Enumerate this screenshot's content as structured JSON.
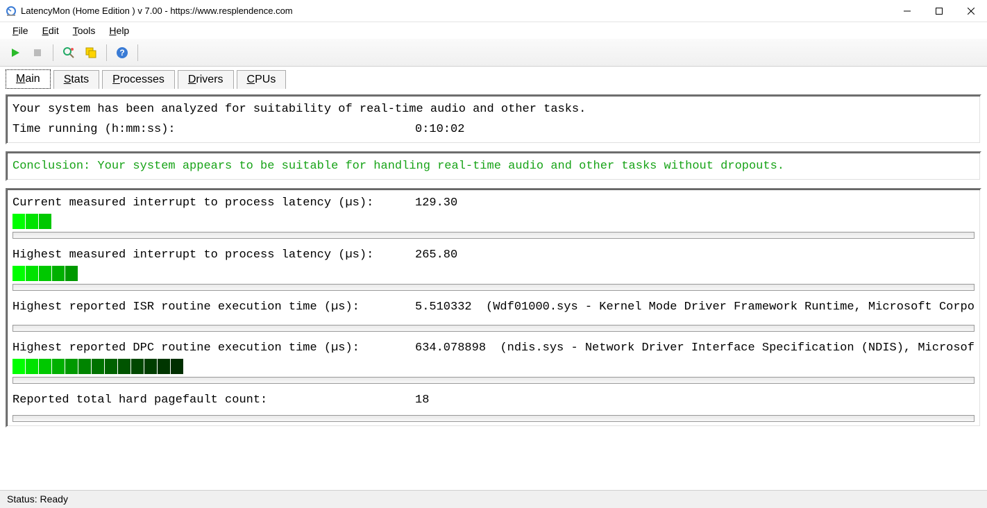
{
  "window": {
    "title": "LatencyMon  (Home Edition )  v 7.00 - https://www.resplendence.com"
  },
  "menu": {
    "file": "File",
    "edit": "Edit",
    "tools": "Tools",
    "help": "Help"
  },
  "tabs": {
    "main": "Main",
    "stats": "Stats",
    "processes": "Processes",
    "drivers": "Drivers",
    "cpus": "CPUs"
  },
  "summary": {
    "line1": "Your system has been analyzed for suitability of real-time audio and other tasks.",
    "time_label": "Time running (h:mm:ss):",
    "time_value": "0:10:02"
  },
  "conclusion": "Conclusion: Your system appears to be suitable for handling real-time audio and other tasks without dropouts.",
  "metrics": {
    "current_label": "Current measured interrupt to process latency (µs):",
    "current_value": "129.30",
    "current_segments": 3,
    "highest_label": "Highest measured interrupt to process latency (µs):",
    "highest_value": "265.80",
    "highest_segments": 5,
    "isr_label": "Highest reported ISR routine execution time (µs):",
    "isr_value": "5.510332",
    "isr_detail": "(Wdf01000.sys - Kernel Mode Driver Framework Runtime, Microsoft Corpo",
    "isr_segments": 0,
    "dpc_label": "Highest reported DPC routine execution time (µs):",
    "dpc_value": "634.078898",
    "dpc_detail": "(ndis.sys - Network Driver Interface Specification (NDIS), Microsof",
    "dpc_segments": 13,
    "pagefault_label": "Reported total hard pagefault count:",
    "pagefault_value": "18"
  },
  "status": "Status: Ready",
  "colors": {
    "bar_gradient": [
      "#00ff00",
      "#00e200",
      "#00c800",
      "#00b000",
      "#009900",
      "#008400",
      "#007200",
      "#006200",
      "#005400",
      "#004800",
      "#003e00",
      "#003600",
      "#002f00"
    ]
  }
}
